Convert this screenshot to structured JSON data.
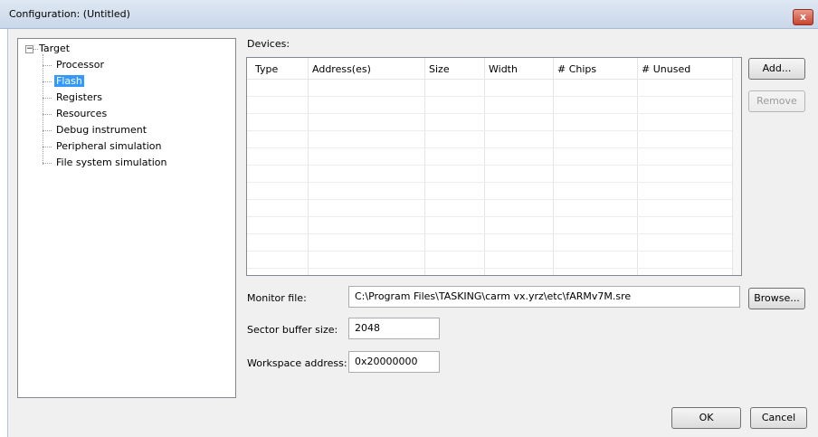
{
  "window": {
    "title": "Configuration: (Untitled)",
    "close_glyph": "x"
  },
  "tree": {
    "root": {
      "label": "Target",
      "expander": "−"
    },
    "items": [
      {
        "label": "Processor"
      },
      {
        "label": "Flash",
        "selected": true
      },
      {
        "label": "Registers"
      },
      {
        "label": "Resources"
      },
      {
        "label": "Debug instrument"
      },
      {
        "label": "Peripheral simulation"
      },
      {
        "label": "File system simulation"
      }
    ]
  },
  "devices": {
    "label": "Devices:",
    "columns": [
      "Type",
      "Address(es)",
      "Size",
      "Width",
      "# Chips",
      "# Unused"
    ],
    "rows": []
  },
  "buttons": {
    "add": "Add...",
    "remove": "Remove",
    "browse": "Browse...",
    "ok": "OK",
    "cancel": "Cancel"
  },
  "fields": {
    "monitor_file": {
      "label": "Monitor file:",
      "value": "C:\\Program Files\\TASKING\\carm vx.yrz\\etc\\fARMv7M.sre"
    },
    "sector_buffer": {
      "label": "Sector buffer size:",
      "value": "2048"
    },
    "workspace": {
      "label": "Workspace address:",
      "value": "0x20000000"
    }
  }
}
